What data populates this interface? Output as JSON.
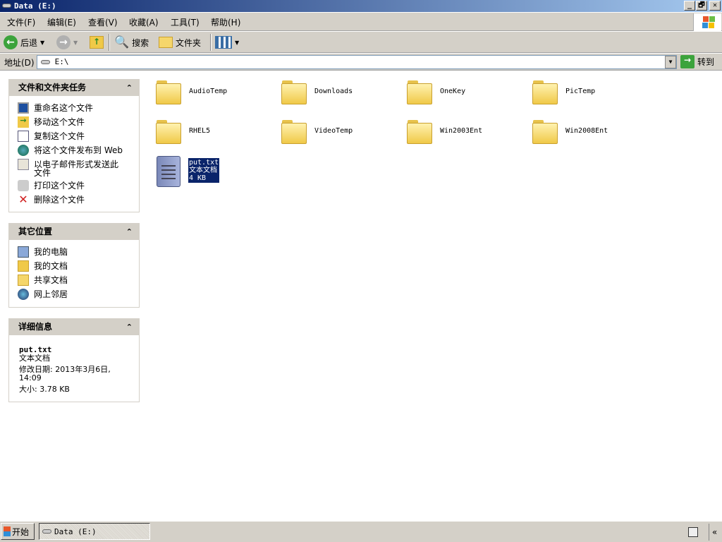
{
  "window": {
    "title": "Data (E:)",
    "min": "_",
    "restore": "🗗",
    "close": "✕"
  },
  "menu": [
    "文件(F)",
    "编辑(E)",
    "查看(V)",
    "收藏(A)",
    "工具(T)",
    "帮助(H)"
  ],
  "toolbar": {
    "back": "后退",
    "search": "搜索",
    "folders": "文件夹"
  },
  "address": {
    "label": "地址(D)",
    "value": "E:\\",
    "go": "转到"
  },
  "tasks": {
    "title": "文件和文件夹任务",
    "items": [
      "重命名这个文件",
      "移动这个文件",
      "复制这个文件",
      "将这个文件发布到 Web",
      "以电子邮件形式发送此文件",
      "打印这个文件",
      "删除这个文件"
    ]
  },
  "places": {
    "title": "其它位置",
    "items": [
      "我的电脑",
      "我的文档",
      "共享文档",
      "网上邻居"
    ]
  },
  "details": {
    "title": "详细信息",
    "name": "put.txt",
    "type": "文本文档",
    "modified": "修改日期: 2013年3月6日, 14:09",
    "size": "大小: 3.78 KB"
  },
  "folders": [
    "AudioTemp",
    "Downloads",
    "OneKey",
    "PicTemp",
    "RHEL5",
    "VideoTemp",
    "Win2003Ent",
    "Win2008Ent"
  ],
  "file": {
    "name": "put.txt",
    "type": "文本文档",
    "size": "4 KB"
  },
  "taskbar": {
    "start": "开始",
    "window": "Data (E:)",
    "collapse": "«"
  }
}
